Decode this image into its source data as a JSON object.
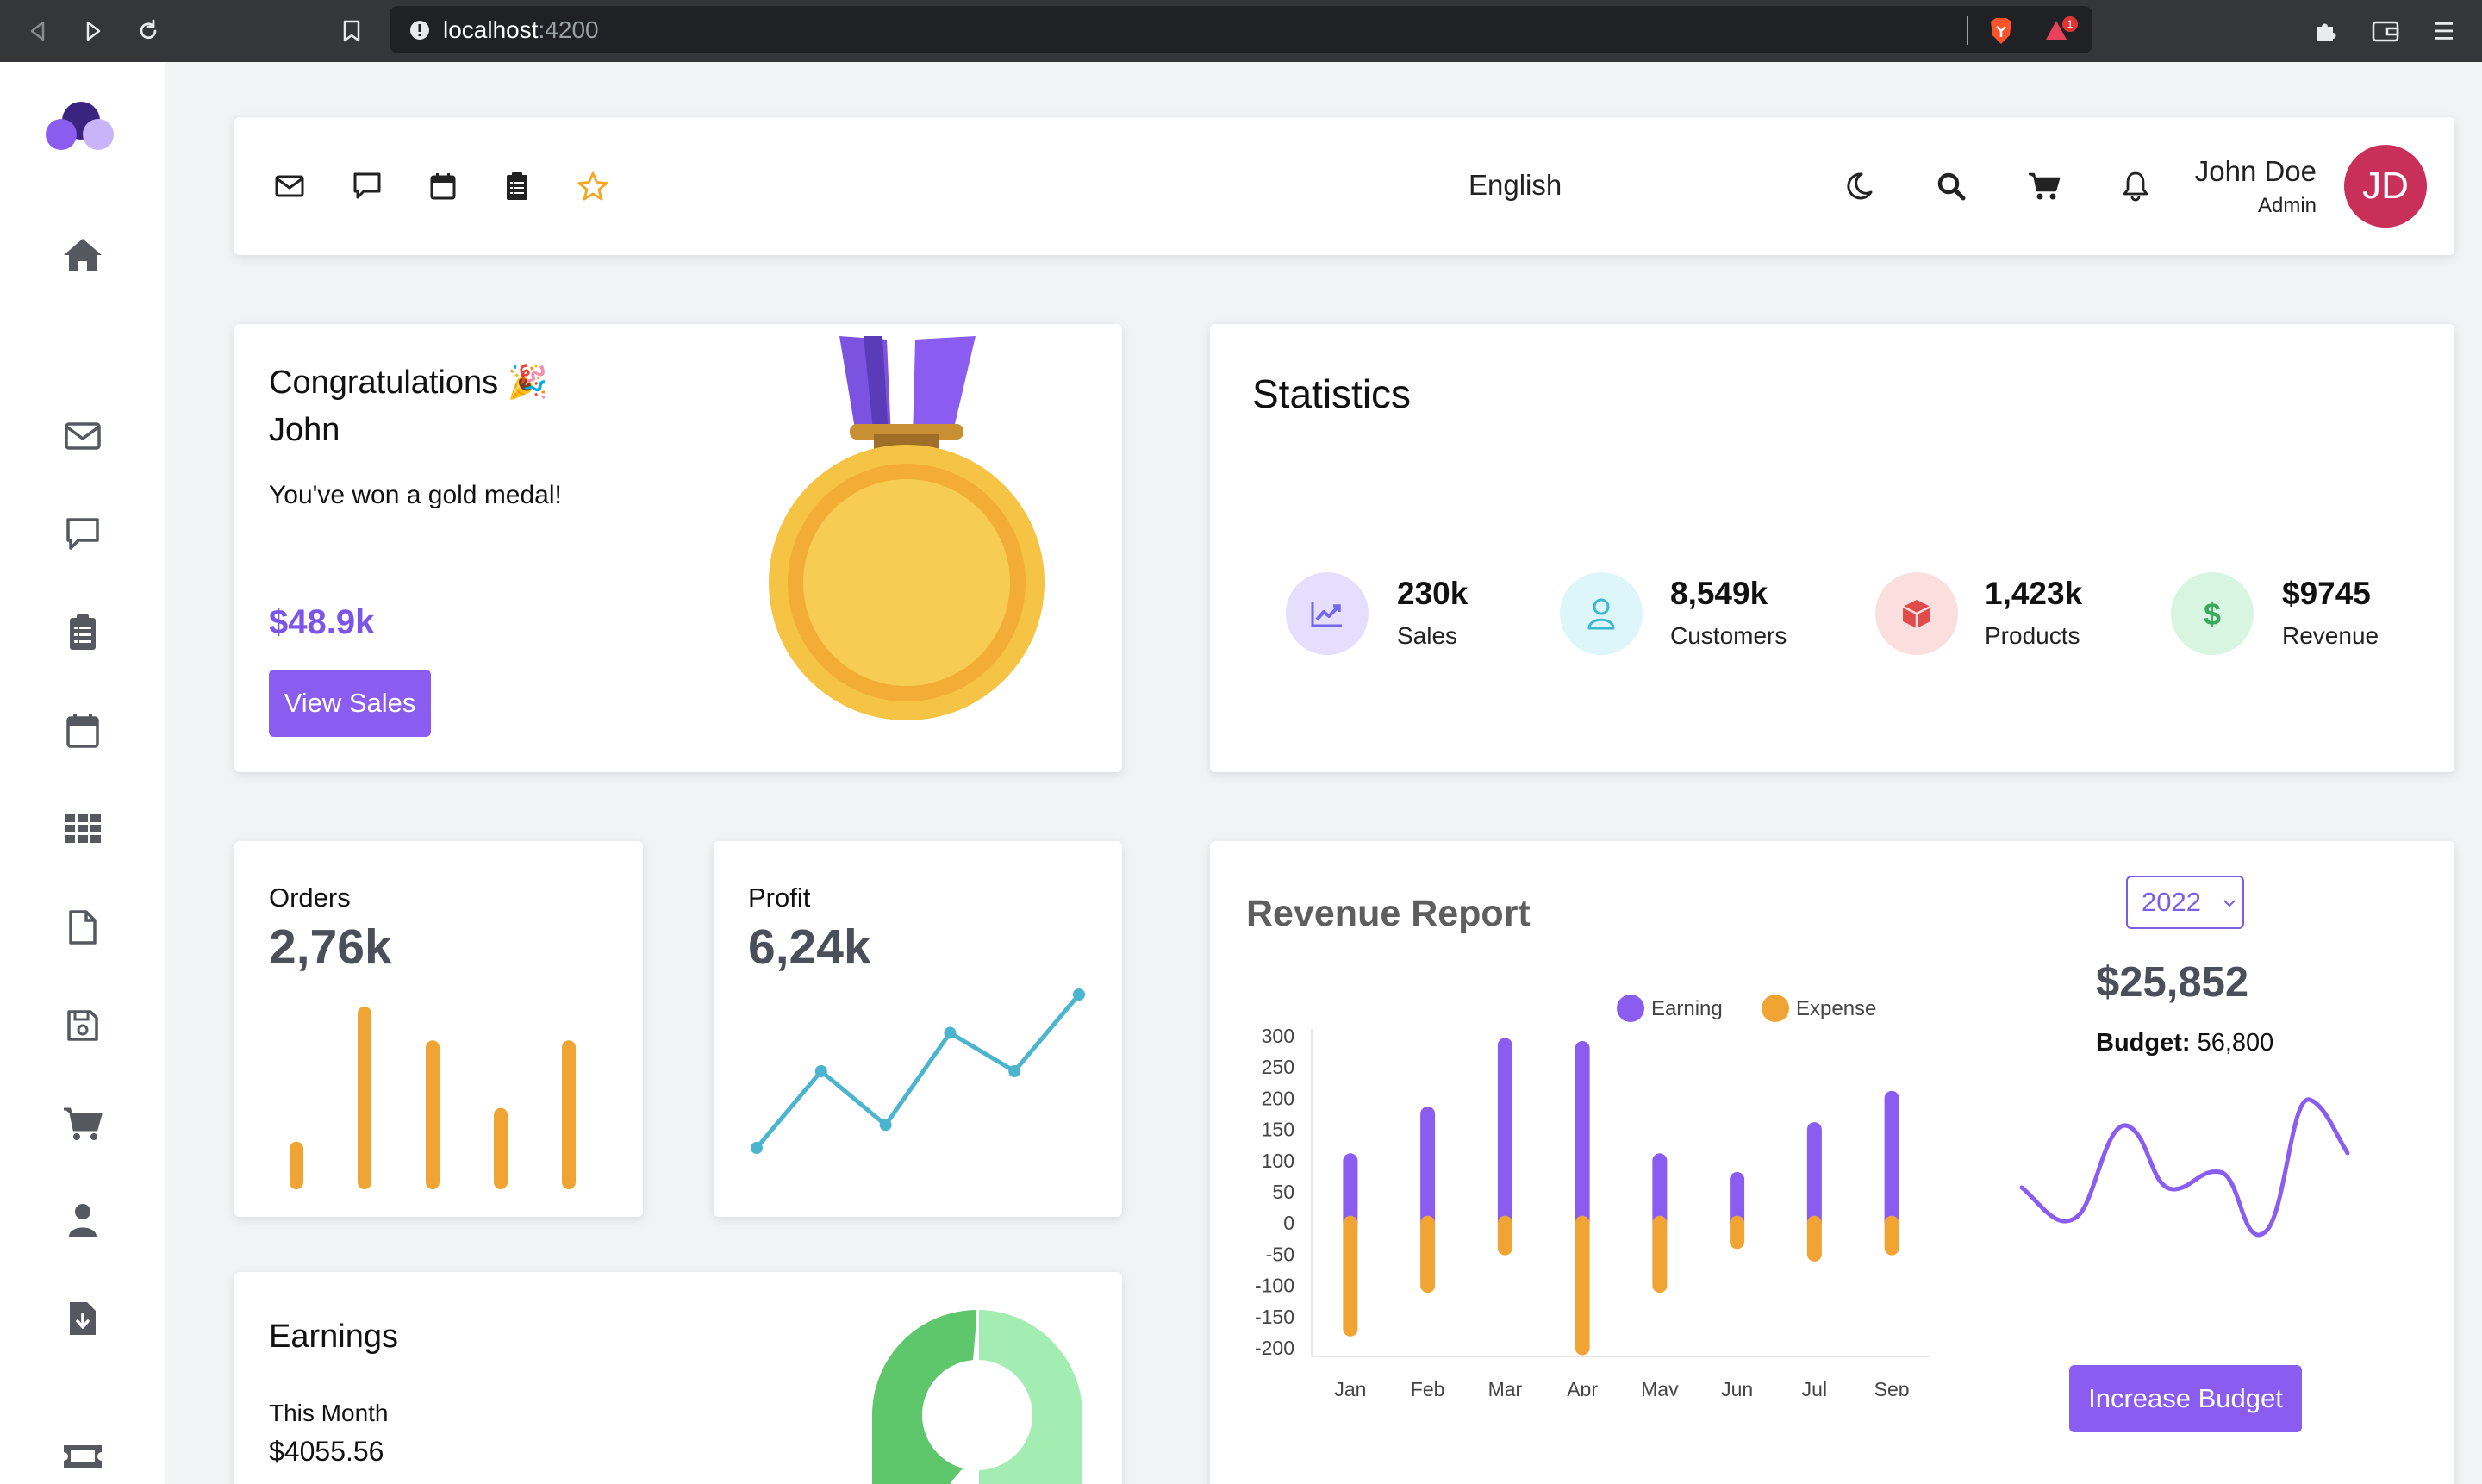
{
  "browser": {
    "url_host": "localhost",
    "url_port": ":4200",
    "notification_count": "1"
  },
  "navbar": {
    "language": "English",
    "user_name": "John Doe",
    "user_role": "Admin",
    "avatar_initials": "JD",
    "icons": [
      "mail-icon",
      "chat-icon",
      "calendar-icon",
      "clipboard-icon",
      "star-icon",
      "moon-icon",
      "search-icon",
      "cart-icon",
      "bell-icon"
    ]
  },
  "sidebar": {
    "icons": [
      "logo",
      "home-icon",
      "mail-icon",
      "chat-icon",
      "clipboard-icon",
      "calendar-icon",
      "grid-icon",
      "file-icon",
      "save-icon",
      "cart-icon",
      "user-icon",
      "download-file-icon",
      "ticket-icon"
    ]
  },
  "congrats": {
    "title_line1": "Congratulations 🎉",
    "title_line2": "John",
    "message": "You've won a gold medal!",
    "amount": "$48.9k",
    "button_label": "View Sales"
  },
  "statistics": {
    "title": "Statistics",
    "items": [
      {
        "value": "230k",
        "label": "Sales",
        "icon": "trending-up-icon",
        "color": "#7367f0",
        "bg": "#e5defc"
      },
      {
        "value": "8,549k",
        "label": "Customers",
        "icon": "user-icon",
        "color": "#3db8d0",
        "bg": "#ddf6fa"
      },
      {
        "value": "1,423k",
        "label": "Products",
        "icon": "box-icon",
        "color": "#e04c4c",
        "bg": "#fbdede"
      },
      {
        "value": "$9745",
        "label": "Revenue",
        "icon": "dollar-icon",
        "color": "#3aa85d",
        "bg": "#d8f5e2"
      }
    ]
  },
  "orders": {
    "title": "Orders",
    "value": "2,76k",
    "bar_color": "#f0a433",
    "bars": [
      0.2,
      1.0,
      0.8,
      0.4,
      0.8
    ]
  },
  "profit": {
    "title": "Profit",
    "value": "6,24k",
    "line_color": "#4bb4cf",
    "points": [
      0,
      0.5,
      0.15,
      0.75,
      0.5,
      1.0
    ]
  },
  "earnings": {
    "title": "Earnings",
    "month_label": "This Month",
    "month_value": "$4055.56",
    "donut_colors": [
      "#a3ecb2",
      "#5fc76b"
    ]
  },
  "revenue_report": {
    "title": "Revenue Report",
    "year": "2022",
    "amount": "$25,852",
    "budget_label": "Budget:",
    "budget_value": "56,800",
    "button_label": "Increase Budget",
    "budget_line_color": "#8a5cf0"
  },
  "chart_data": {
    "type": "bar",
    "stacked": true,
    "categories": [
      "Jan",
      "Feb",
      "Mar",
      "Apr",
      "May",
      "Jun",
      "Jul",
      "Sep"
    ],
    "series": [
      {
        "name": "Earning",
        "color": "#8a5cf0",
        "values": [
          100,
          175,
          285,
          280,
          100,
          70,
          150,
          200
        ]
      },
      {
        "name": "Expense",
        "color": "#f0a433",
        "values": [
          -170,
          -100,
          -40,
          -200,
          -100,
          -30,
          -50,
          -40
        ]
      }
    ],
    "ylim": [
      -200,
      300
    ],
    "yticks": [
      300,
      250,
      200,
      150,
      100,
      50,
      0,
      -50,
      -100,
      -150,
      -200
    ],
    "legend_position": "top-right"
  }
}
